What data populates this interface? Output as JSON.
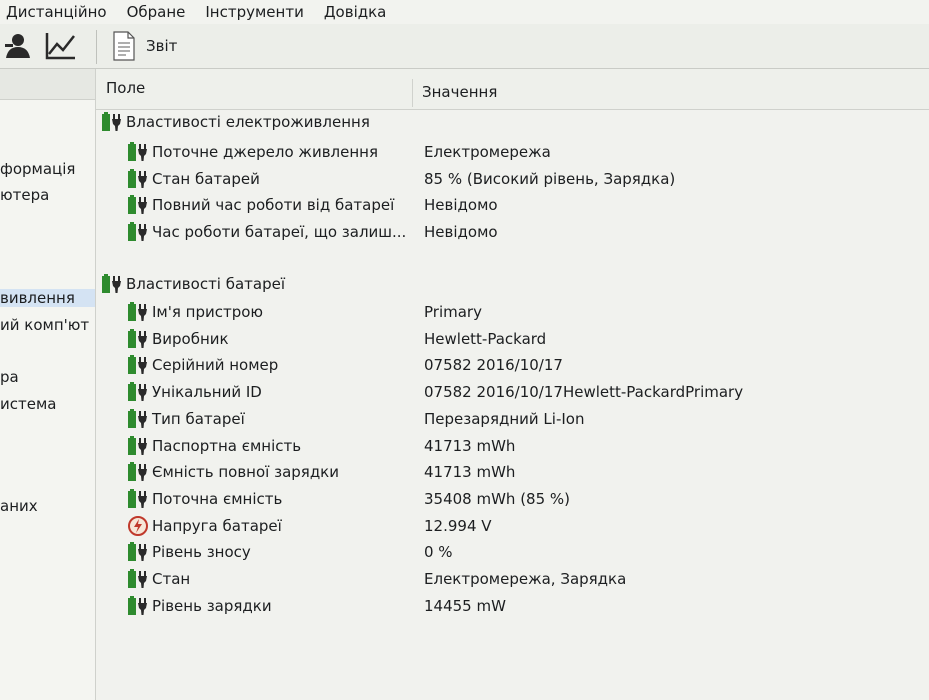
{
  "menu": [
    "Дистанційно",
    "Обране",
    "Інструменти",
    "Довідка"
  ],
  "toolbar": {
    "report_label": "Звіт"
  },
  "left_tree": [
    "формація",
    "ютера",
    "вивлення",
    "ий комп'ют",
    "ра",
    "истема",
    "аних"
  ],
  "columns": {
    "field": "Поле",
    "value": "Значення"
  },
  "groups": [
    {
      "label": "Властивості електроживлення",
      "rows": [
        {
          "field": "Поточне джерело живлення",
          "value": "Електромережа"
        },
        {
          "field": "Стан батарей",
          "value": "85 % (Високий рівень, Зарядка)"
        },
        {
          "field": "Повний час роботи від батареї",
          "value": "Невідомо"
        },
        {
          "field": "Час роботи батареї, що залиш...",
          "value": "Невідомо"
        }
      ]
    },
    {
      "label": "Властивості батареї",
      "rows": [
        {
          "field": "Ім'я пристрою",
          "value": "Primary"
        },
        {
          "field": "Виробник",
          "value": "Hewlett-Packard"
        },
        {
          "field": "Серійний номер",
          "value": "07582 2016/10/17"
        },
        {
          "field": "Унікальний ID",
          "value": "07582 2016/10/17Hewlett-PackardPrimary"
        },
        {
          "field": "Тип батареї",
          "value": "Перезарядний Li-Ion"
        },
        {
          "field": "Паспортна ємність",
          "value": "41713 mWh"
        },
        {
          "field": "Ємність повної зарядки",
          "value": "41713 mWh"
        },
        {
          "field": "Поточна ємність",
          "value": "35408 mWh  (85 %)"
        },
        {
          "field": "Напруга батареї",
          "value": "12.994 V"
        },
        {
          "field": "Рівень зносу",
          "value": "0 %"
        },
        {
          "field": "Стан",
          "value": "Електромережа, Зарядка"
        },
        {
          "field": "Рівень зарядки",
          "value": "14455 mW"
        }
      ]
    }
  ],
  "colors": {
    "battery_green": "#2e8b2e",
    "plug_dark": "#2a2a2a",
    "voltage_red": "#c0392b",
    "selection": "#d4e3f3"
  }
}
